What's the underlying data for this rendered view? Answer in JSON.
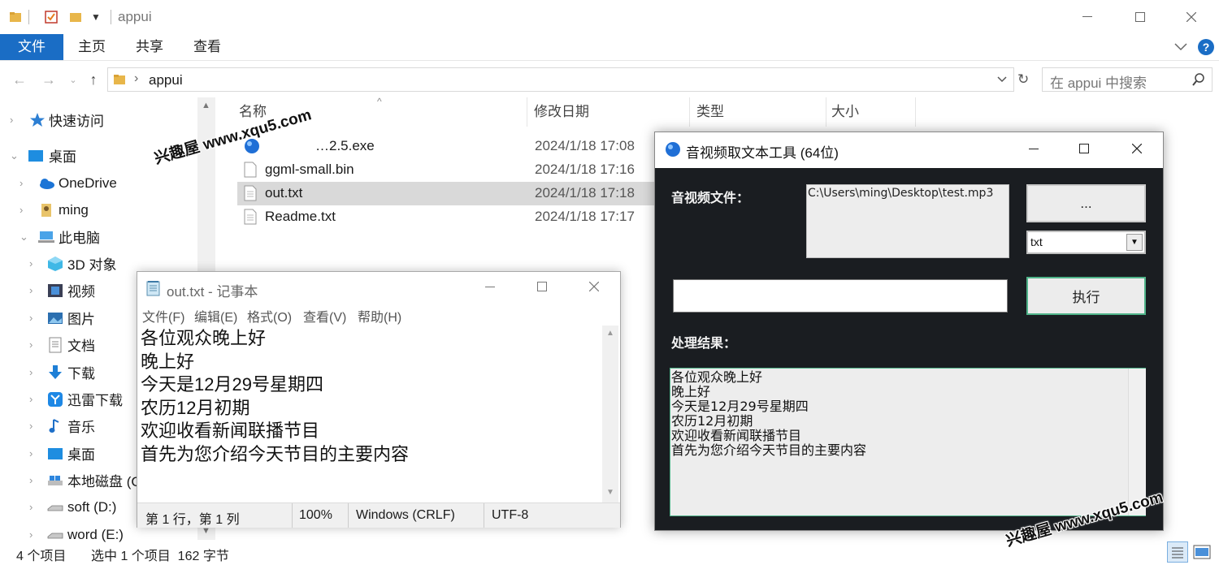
{
  "explorer": {
    "title": "appui",
    "ribbon_tabs": [
      "文件",
      "主页",
      "共享",
      "查看"
    ],
    "path": "appui",
    "search_placeholder": "在 appui 中搜索",
    "sidebar": [
      {
        "label": "快速访问",
        "icon": "star-icon"
      },
      {
        "label": "桌面",
        "icon": "desktop-icon"
      },
      {
        "label": "OneDrive",
        "icon": "cloud-icon"
      },
      {
        "label": "ming",
        "icon": "user-icon"
      },
      {
        "label": "此电脑",
        "icon": "computer-icon"
      },
      {
        "label": "3D 对象",
        "icon": "cube-icon"
      },
      {
        "label": "视频",
        "icon": "video-icon"
      },
      {
        "label": "图片",
        "icon": "picture-icon"
      },
      {
        "label": "文档",
        "icon": "document-icon"
      },
      {
        "label": "下载",
        "icon": "download-icon"
      },
      {
        "label": "迅雷下载",
        "icon": "thunder-icon"
      },
      {
        "label": "音乐",
        "icon": "music-icon"
      },
      {
        "label": "桌面",
        "icon": "desktop-icon"
      },
      {
        "label": "本地磁盘 (C",
        "icon": "drive-icon"
      },
      {
        "label": "soft (D:)",
        "icon": "drive-icon"
      },
      {
        "label": "word (E:)",
        "icon": "drive-icon"
      }
    ],
    "columns": {
      "name": "名称",
      "date": "修改日期",
      "type": "类型",
      "size": "大小"
    },
    "files": [
      {
        "name": "…2.5.exe",
        "date": "2024/1/18 17:08",
        "icon": "app-icon"
      },
      {
        "name": "ggml-small.bin",
        "date": "2024/1/18 17:16",
        "icon": "file-icon"
      },
      {
        "name": "out.txt",
        "date": "2024/1/18 17:18",
        "icon": "file-icon"
      },
      {
        "name": "Readme.txt",
        "date": "2024/1/18 17:17",
        "icon": "file-icon"
      }
    ],
    "status": {
      "count": "4 个项目",
      "selected": "选中 1 个项目  162 字节"
    }
  },
  "notepad": {
    "title": "out.txt - 记事本",
    "menu": [
      "文件(F)",
      "编辑(E)",
      "格式(O)",
      "查看(V)",
      "帮助(H)"
    ],
    "lines": [
      "各位观众晚上好",
      "晚上好",
      "今天是12月29号星期四",
      "农历12月初期",
      "欢迎收看新闻联播节目",
      "首先为您介绍今天节目的主要内容"
    ],
    "status": {
      "position": "第 1 行，第 1 列",
      "zoom": "100%",
      "eol": "Windows (CRLF)",
      "encoding": "UTF-8"
    }
  },
  "tool": {
    "title": "音视频取文本工具 (64位)",
    "file_label": "音视频文件：",
    "file_path": "C:\\Users\\ming\\Desktop\\test.mp3",
    "browse_label": "...",
    "format": "txt",
    "run_label": "执行",
    "result_label": "处理结果：",
    "result_lines": [
      "各位观众晚上好",
      "晚上好",
      "今天是12月29号星期四",
      "农历12月初期",
      "欢迎收看新闻联播节目",
      "首先为您介绍今天节目的主要内容"
    ]
  },
  "watermark": {
    "text": "兴趣屋 www.xqu5.com"
  }
}
